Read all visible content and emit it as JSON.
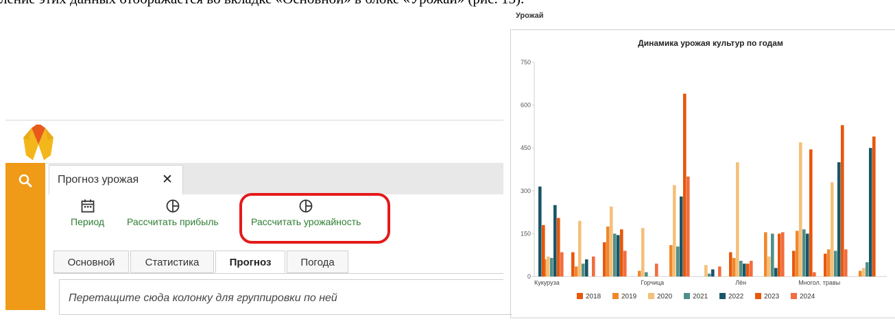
{
  "document": {
    "top_text": "ление этих данных отображается во вкладке «Основной» в блоке «Урожай» (рис. 13)."
  },
  "app": {
    "tab_title": "Прогноз урожая",
    "tab_close": "✕",
    "toolbar": {
      "period_label": "Период",
      "profit_label": "Рассчитать прибыль",
      "yield_label": "Рассчитать урожайность"
    },
    "subtabs": [
      "Основной",
      "Статистика",
      "Прогноз",
      "Погода"
    ],
    "active_subtab": "Прогноз",
    "group_hint": "Перетащите сюда колонку для группировки по ней",
    "accent_color": "#ef9b18",
    "highlight_color": "#e41a1a",
    "toolbar_text_color": "#2e7d32"
  },
  "panel": {
    "title": "Урожай"
  },
  "chart_data": {
    "type": "bar",
    "title": "Динамика урожая культур по годам",
    "ylim": [
      0,
      750
    ],
    "yticks": [
      0,
      150,
      300,
      450,
      600,
      750
    ],
    "grid": false,
    "legend_position": "bottom",
    "categories": [
      "Кукуруза",
      "",
      "",
      "Горчица",
      "",
      "",
      "Лён",
      "",
      "Многол. травы",
      "",
      ""
    ],
    "series": [
      {
        "name": "2018",
        "color": "#e8590c",
        "values": [
          0,
          85,
          120,
          0,
          0,
          0,
          85,
          0,
          90,
          80,
          0
        ]
      },
      {
        "name": "2019",
        "color": "#f0882a",
        "values": [
          60,
          35,
          175,
          20,
          110,
          0,
          65,
          155,
          160,
          95,
          20
        ]
      },
      {
        "name": "2020",
        "color": "#f4c07a",
        "values": [
          70,
          195,
          245,
          170,
          320,
          40,
          400,
          70,
          470,
          330,
          30
        ]
      },
      {
        "name": "2021",
        "color": "#4f8f8a",
        "values": [
          65,
          45,
          150,
          15,
          105,
          10,
          55,
          150,
          165,
          90,
          50
        ]
      },
      {
        "name": "2022",
        "color": "#1a5566",
        "values": [
          250,
          60,
          145,
          0,
          280,
          25,
          45,
          30,
          150,
          400,
          450
        ]
      },
      {
        "name": "2023",
        "color": "#e8570a",
        "values": [
          205,
          0,
          165,
          0,
          640,
          0,
          45,
          150,
          445,
          530,
          490
        ]
      },
      {
        "name": "2024",
        "color": "#f26d40",
        "values": [
          85,
          70,
          90,
          45,
          350,
          35,
          55,
          155,
          15,
          95,
          0
        ]
      }
    ],
    "extra_leading": {
      "series_index": 4,
      "value": 315,
      "second_value": 180
    },
    "legend": [
      "2018",
      "2019",
      "2020",
      "2021",
      "2022",
      "2023",
      "2024"
    ]
  }
}
